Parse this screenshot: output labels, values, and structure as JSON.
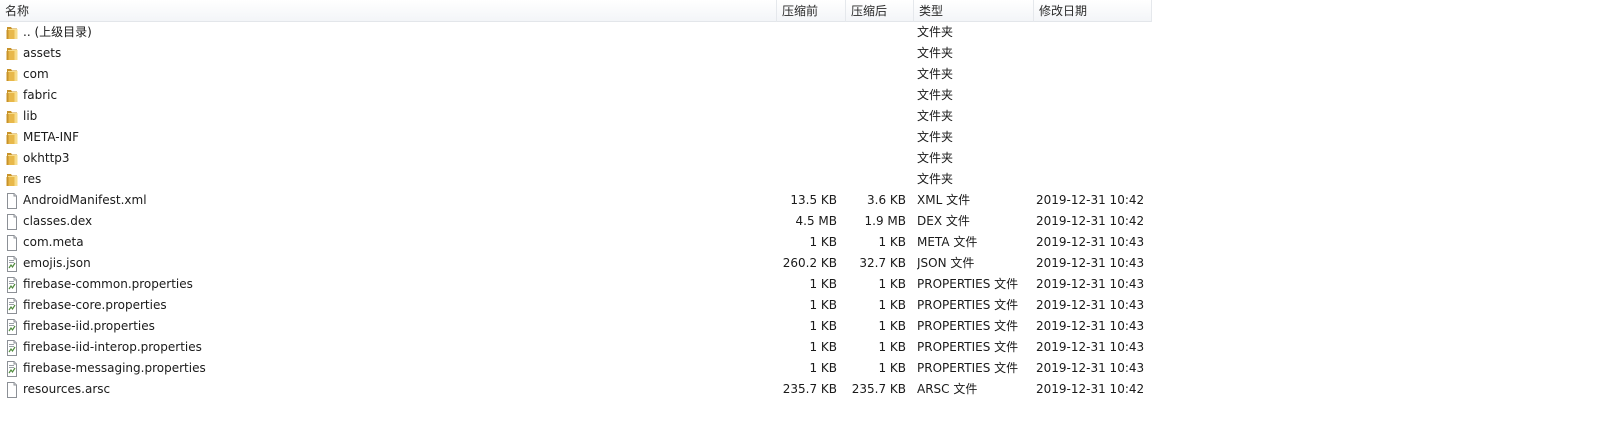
{
  "columns": {
    "name": "名称",
    "original_size": "压缩前",
    "compressed_size": "压缩后",
    "type": "类型",
    "modified": "修改日期"
  },
  "rows": [
    {
      "name": ".. (上级目录)",
      "icon": "folder-icon",
      "original_size": "",
      "compressed_size": "",
      "type": "文件夹",
      "modified": ""
    },
    {
      "name": "assets",
      "icon": "folder-icon",
      "original_size": "",
      "compressed_size": "",
      "type": "文件夹",
      "modified": ""
    },
    {
      "name": "com",
      "icon": "folder-icon",
      "original_size": "",
      "compressed_size": "",
      "type": "文件夹",
      "modified": ""
    },
    {
      "name": "fabric",
      "icon": "folder-icon",
      "original_size": "",
      "compressed_size": "",
      "type": "文件夹",
      "modified": ""
    },
    {
      "name": "lib",
      "icon": "folder-icon",
      "original_size": "",
      "compressed_size": "",
      "type": "文件夹",
      "modified": ""
    },
    {
      "name": "META-INF",
      "icon": "folder-icon",
      "original_size": "",
      "compressed_size": "",
      "type": "文件夹",
      "modified": ""
    },
    {
      "name": "okhttp3",
      "icon": "folder-icon",
      "original_size": "",
      "compressed_size": "",
      "type": "文件夹",
      "modified": ""
    },
    {
      "name": "res",
      "icon": "folder-icon",
      "original_size": "",
      "compressed_size": "",
      "type": "文件夹",
      "modified": ""
    },
    {
      "name": "AndroidManifest.xml",
      "icon": "file-icon",
      "original_size": "13.5 KB",
      "compressed_size": "3.6 KB",
      "type": "XML 文件",
      "modified": "2019-12-31 10:42"
    },
    {
      "name": "classes.dex",
      "icon": "file-icon",
      "original_size": "4.5 MB",
      "compressed_size": "1.9 MB",
      "type": "DEX 文件",
      "modified": "2019-12-31 10:42"
    },
    {
      "name": "com.meta",
      "icon": "file-icon",
      "original_size": "1 KB",
      "compressed_size": "1 KB",
      "type": "META 文件",
      "modified": "2019-12-31 10:43"
    },
    {
      "name": "emojis.json",
      "icon": "config-file-icon",
      "original_size": "260.2 KB",
      "compressed_size": "32.7 KB",
      "type": "JSON 文件",
      "modified": "2019-12-31 10:43"
    },
    {
      "name": "firebase-common.properties",
      "icon": "config-file-icon",
      "original_size": "1 KB",
      "compressed_size": "1 KB",
      "type": "PROPERTIES 文件",
      "modified": "2019-12-31 10:43"
    },
    {
      "name": "firebase-core.properties",
      "icon": "config-file-icon",
      "original_size": "1 KB",
      "compressed_size": "1 KB",
      "type": "PROPERTIES 文件",
      "modified": "2019-12-31 10:43"
    },
    {
      "name": "firebase-iid.properties",
      "icon": "config-file-icon",
      "original_size": "1 KB",
      "compressed_size": "1 KB",
      "type": "PROPERTIES 文件",
      "modified": "2019-12-31 10:43"
    },
    {
      "name": "firebase-iid-interop.properties",
      "icon": "config-file-icon",
      "original_size": "1 KB",
      "compressed_size": "1 KB",
      "type": "PROPERTIES 文件",
      "modified": "2019-12-31 10:43"
    },
    {
      "name": "firebase-messaging.properties",
      "icon": "config-file-icon",
      "original_size": "1 KB",
      "compressed_size": "1 KB",
      "type": "PROPERTIES 文件",
      "modified": "2019-12-31 10:43"
    },
    {
      "name": "resources.arsc",
      "icon": "file-icon",
      "original_size": "235.7 KB",
      "compressed_size": "235.7 KB",
      "type": "ARSC 文件",
      "modified": "2019-12-31 10:42"
    }
  ],
  "colors": {
    "folder": "#e8b84a",
    "folder_dark": "#c8932a",
    "file_border": "#8c9096",
    "config_accent": "#4f8a3c"
  }
}
